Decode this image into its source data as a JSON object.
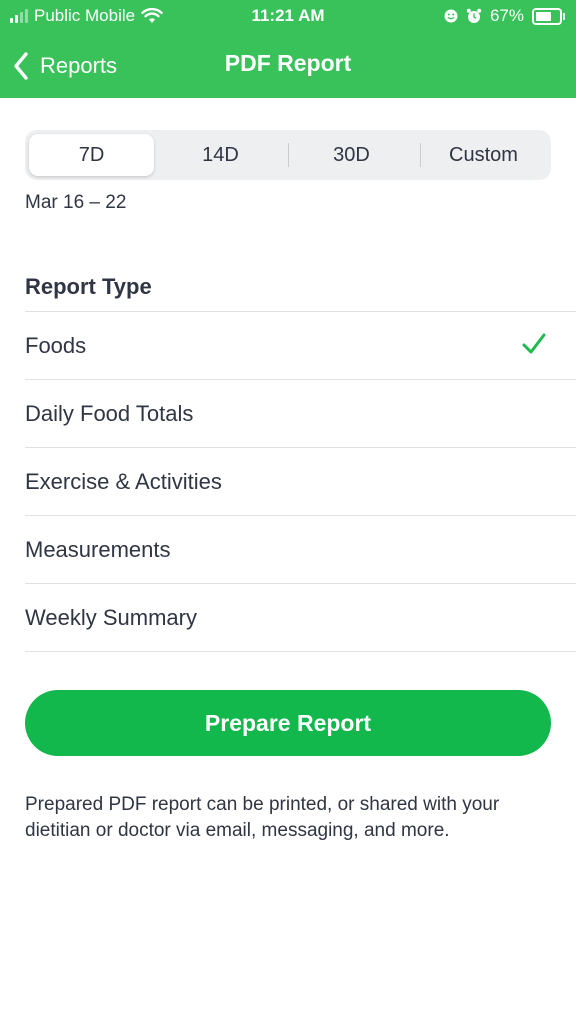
{
  "status_bar": {
    "carrier": "Public Mobile",
    "time": "11:21 AM",
    "battery_percent": "67%",
    "battery_level": 0.67,
    "icons": [
      "signal-icon",
      "wifi-icon",
      "face-icon",
      "alarm-icon",
      "battery-icon"
    ]
  },
  "nav": {
    "back_label": "Reports",
    "title": "PDF Report"
  },
  "range": {
    "segments": [
      "7D",
      "14D",
      "30D",
      "Custom"
    ],
    "selected": "7D",
    "date_range": "Mar 16 – 22"
  },
  "report_type": {
    "title": "Report Type",
    "items": [
      {
        "label": "Foods",
        "checked": true
      },
      {
        "label": "Daily Food Totals",
        "checked": false
      },
      {
        "label": "Exercise & Activities",
        "checked": false
      },
      {
        "label": "Measurements",
        "checked": false
      },
      {
        "label": "Weekly Summary",
        "checked": false
      }
    ]
  },
  "action": {
    "prepare_label": "Prepare Report",
    "footnote": "Prepared PDF report can be printed, or shared with your dietitian or doctor via email, messaging, and more."
  },
  "colors": {
    "brand_green": "#39c15a",
    "button_green": "#13b84c",
    "check_green": "#1fba4f",
    "text": "#2f3542"
  }
}
